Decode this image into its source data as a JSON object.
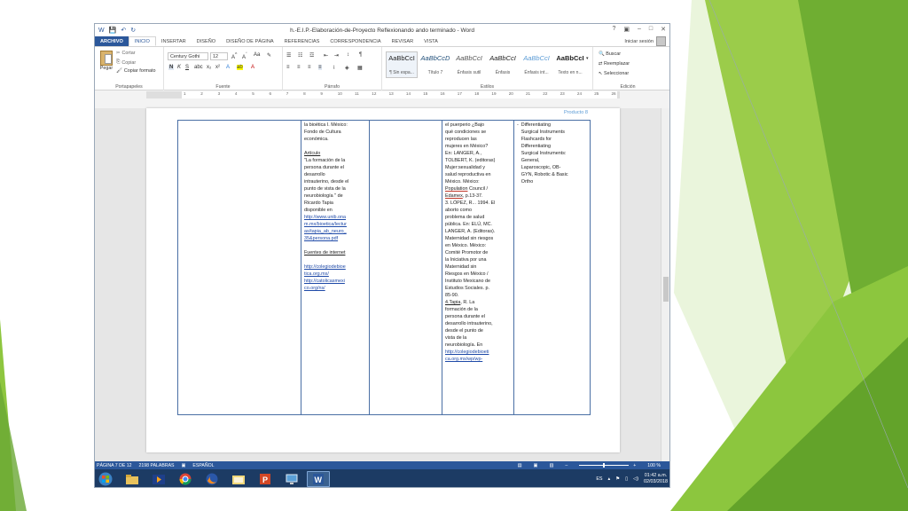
{
  "window": {
    "title": "h.-E.I.P.-Elaboración-de-Proyecto Reflexionando ando terminado - Word",
    "controls": [
      "?",
      "▣",
      "–",
      "□",
      "✕"
    ]
  },
  "tabs": [
    "ARCHIVO",
    "INICIO",
    "INSERTAR",
    "DISEÑO",
    "DISEÑO DE PÁGINA",
    "REFERENCIAS",
    "CORRESPONDENCIA",
    "REVISAR",
    "VISTA"
  ],
  "signin": "Iniciar sesión",
  "ribbon": {
    "clipboard": {
      "paste": "Pegar",
      "cut": "Cortar",
      "copy": "Copiar",
      "format_painter": "Copiar formato",
      "label": "Portapapeles"
    },
    "font": {
      "name": "Century Gothi",
      "size": "12",
      "label": "Fuente"
    },
    "paragraph": {
      "label": "Párrafo"
    },
    "styles": {
      "items": [
        {
          "preview": "AaBbCcI",
          "name": "¶ Sin espa..."
        },
        {
          "preview": "AaBbCcD",
          "name": "Título 7"
        },
        {
          "preview": "AaBbCcI",
          "name": "Énfasis sutil"
        },
        {
          "preview": "AaBbCcI",
          "name": "Énfasis"
        },
        {
          "preview": "AaBbCcI",
          "name": "Énfasis int..."
        },
        {
          "preview": "AaBbCcI",
          "name": "Texto en n..."
        }
      ],
      "label": "Estilos"
    },
    "editing": {
      "find": "Buscar",
      "replace": "Reemplazar",
      "select": "Seleccionar",
      "label": "Edición"
    }
  },
  "ruler": [
    "1",
    "2",
    "3",
    "4",
    "5",
    "6",
    "7",
    "8",
    "9",
    "10",
    "11",
    "12",
    "13",
    "14",
    "15",
    "16",
    "17",
    "18",
    "19",
    "20",
    "21",
    "22",
    "23",
    "24",
    "25",
    "26"
  ],
  "document": {
    "header": "Producto 8",
    "col1": {
      "line1": "la bioética I. México:",
      "line2": "Fondo de Cultura",
      "line3": "económica.",
      "articulo_heading": "Artículo",
      "article_lines": [
        "\"La formación de la",
        "persona durante el",
        "desarrollo",
        "intrauterino, desde el",
        "punto de vista de la",
        "neurobiología \" de",
        "Ricardo Tapia",
        "disponible en"
      ],
      "article_link_lines": [
        "http://www.unib.ona",
        "m.mx/bioetica/lectur",
        "as/tapia_ab_neuro_",
        "35&persona.pdf"
      ],
      "fuentes_heading": "Fuentes de internet",
      "link1_lines": [
        "http://colegiodebioe",
        "tica.org.mx/"
      ],
      "link2_lines": [
        "http://catolicasmexi",
        "co.org/ns/"
      ]
    },
    "col3": {
      "lines_a": [
        "el puerperio ¿Bajo",
        "qué condiciones se",
        "reproducen las",
        "mujeres en México?",
        "En: LANGER, A.,",
        "TOLBERT, K. (editoras)",
        "Mujer:sexualidad y",
        "salud reproductiva en",
        "México. México:"
      ],
      "spell1": "Population",
      "spell1_rest": " Council /",
      "spell2": "Edamex",
      "spell2_rest": ", p.13-37.",
      "lines_b": [
        "3. LÓPEZ, R... 1994. El",
        "aborto como",
        "problema de salud",
        "pública. En: ELÚ, MC.",
        "LANGER, A. (Editoras).",
        "Maternidad sin riesgos",
        "en México. México:",
        "Comité Promotor de",
        "la Iniciativa por una",
        "Maternidad sin",
        "Riesgos en México /",
        "Instituto Mexicano de",
        "Estudios Sociales. p.",
        "85-90."
      ],
      "spell3": "4.Tapia",
      "spell3_rest": ", R. La",
      "lines_c": [
        "formación de la",
        "persona durante el",
        "desarrollo intrauterino,",
        "desde el punto de",
        "vista de la",
        "neurobiología. En"
      ],
      "link_lines": [
        "http://colegiodebioeti",
        "ca.org.mx/wp/wp-"
      ]
    },
    "col4": {
      "bullet": "-",
      "lines": [
        "Differentiating",
        "Surgical Instruments",
        "Flashcards for",
        "Differentiating",
        "Surgical Instruments:",
        "General,",
        "Laparoscopic, OB-",
        "GYN, Robotic & Basic",
        "Ortho"
      ]
    }
  },
  "statusbar": {
    "page": "PÁGINA 7 DE 12",
    "words": "2198 PALABRAS",
    "language": "ESPAÑOL",
    "zoom": "100 %",
    "zoom_fraction": 0.5
  },
  "taskbar": {
    "apps": [
      "explorer-app",
      "media-player-app",
      "chrome-app",
      "firefox-app",
      "folder-app",
      "powerpoint-app",
      "remote-app",
      "word-app"
    ],
    "lang": "ES",
    "time": "01:42 a.m.",
    "date": "02/03/2018"
  },
  "colors": {
    "word_blue": "#2b579a",
    "green_light": "#9bcc4a",
    "green_dark": "#5a9a2a"
  }
}
